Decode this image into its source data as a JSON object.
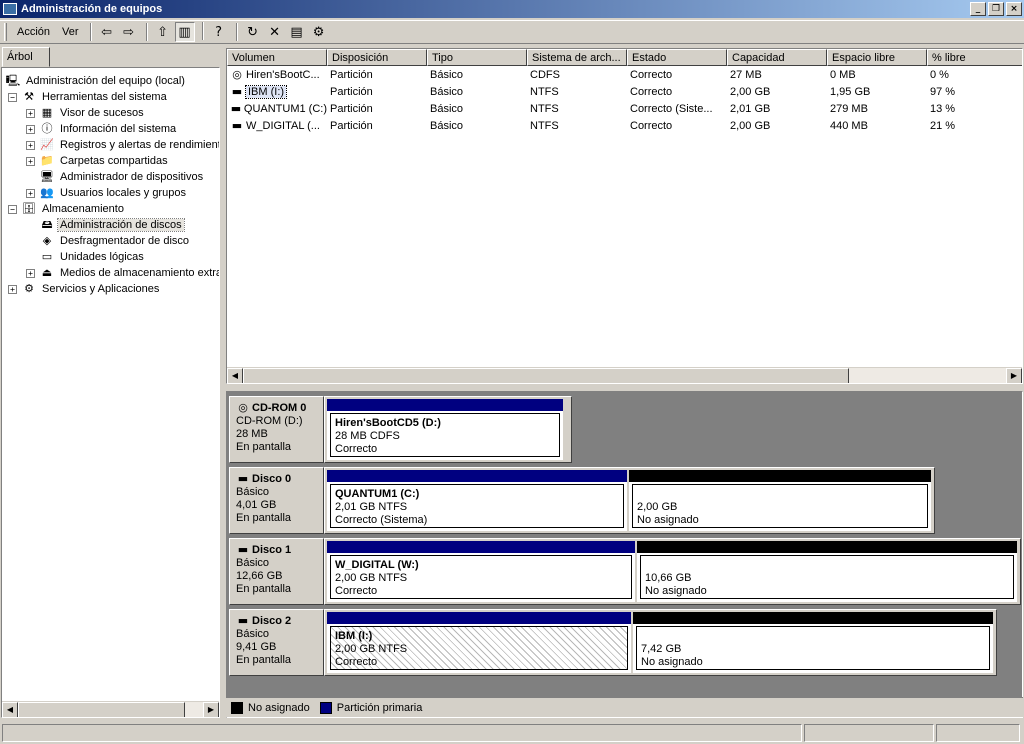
{
  "window": {
    "title": "Administración de equipos",
    "controls": [
      "_",
      "❐",
      "×"
    ]
  },
  "menu": {
    "items": [
      "Acción",
      "Ver"
    ]
  },
  "toolbar": {
    "buttons": [
      {
        "icon": "back-arrow-icon",
        "glyph": "⇦"
      },
      {
        "icon": "forward-arrow-icon",
        "glyph": "⇨"
      },
      {
        "icon": "up-folder-icon",
        "glyph": "⇧"
      },
      {
        "icon": "show-hide-tree-icon",
        "glyph": "▥",
        "pressed": true
      },
      {
        "icon": "help-icon",
        "glyph": "?"
      },
      {
        "icon": "refresh-icon",
        "glyph": "↻"
      },
      {
        "icon": "delete-icon",
        "glyph": "✕"
      },
      {
        "icon": "properties-icon",
        "glyph": "▤"
      },
      {
        "icon": "settings-icon",
        "glyph": "⚙"
      }
    ]
  },
  "tree": {
    "tab_label": "Árbol",
    "items": [
      {
        "label": "Administración del equipo (local)",
        "level": 0,
        "expander": "",
        "icon": "computer-icon",
        "glyph": "🖳"
      },
      {
        "label": "Herramientas del sistema",
        "level": 1,
        "expander": "−",
        "icon": "tools-icon",
        "glyph": "⚒"
      },
      {
        "label": "Visor de sucesos",
        "level": 2,
        "expander": "+",
        "icon": "event-viewer-icon",
        "glyph": "▦"
      },
      {
        "label": "Información del sistema",
        "level": 2,
        "expander": "+",
        "icon": "system-info-icon",
        "glyph": "ⓘ"
      },
      {
        "label": "Registros y alertas de rendimient",
        "level": 2,
        "expander": "+",
        "icon": "performance-icon",
        "glyph": "📈"
      },
      {
        "label": "Carpetas compartidas",
        "level": 2,
        "expander": "+",
        "icon": "shared-folder-icon",
        "glyph": "📁"
      },
      {
        "label": "Administrador de dispositivos",
        "level": 2,
        "expander": "",
        "icon": "device-manager-icon",
        "glyph": "🖥"
      },
      {
        "label": "Usuarios locales y grupos",
        "level": 2,
        "expander": "+",
        "icon": "users-icon",
        "glyph": "👥"
      },
      {
        "label": "Almacenamiento",
        "level": 1,
        "expander": "−",
        "icon": "storage-icon",
        "glyph": "🗄"
      },
      {
        "label": "Administración de discos",
        "level": 2,
        "expander": "",
        "icon": "disk-management-icon",
        "glyph": "🖴",
        "selected": true
      },
      {
        "label": "Desfragmentador de disco",
        "level": 2,
        "expander": "",
        "icon": "defrag-icon",
        "glyph": "◈"
      },
      {
        "label": "Unidades lógicas",
        "level": 2,
        "expander": "",
        "icon": "logical-drive-icon",
        "glyph": "▭"
      },
      {
        "label": "Medios de almacenamiento extraí",
        "level": 2,
        "expander": "+",
        "icon": "removable-storage-icon",
        "glyph": "⏏"
      },
      {
        "label": "Servicios y Aplicaciones",
        "level": 1,
        "expander": "+",
        "icon": "services-icon",
        "glyph": "⚙"
      }
    ]
  },
  "volume_list": {
    "columns": [
      "Volumen",
      "Disposición",
      "Tipo",
      "Sistema de arch...",
      "Estado",
      "Capacidad",
      "Espacio libre",
      "% libre"
    ],
    "rows": [
      {
        "icon": "cdrom-icon",
        "glyph": "◎",
        "cells": [
          "Hiren'sBootC...",
          "Partición",
          "Básico",
          "CDFS",
          "Correcto",
          "27 MB",
          "0 MB",
          "0 %"
        ]
      },
      {
        "icon": "hard-drive-icon",
        "glyph": "▬",
        "cells": [
          "IBM (I:)",
          "Partición",
          "Básico",
          "NTFS",
          "Correcto",
          "2,00 GB",
          "1,95 GB",
          "97 %"
        ],
        "selected": true
      },
      {
        "icon": "hard-drive-icon",
        "glyph": "▬",
        "cells": [
          "QUANTUM1 (C:)",
          "Partición",
          "Básico",
          "NTFS",
          "Correcto (Siste...",
          "2,01 GB",
          "279 MB",
          "13 %"
        ]
      },
      {
        "icon": "hard-drive-icon",
        "glyph": "▬",
        "cells": [
          "W_DIGITAL (...",
          "Partición",
          "Básico",
          "NTFS",
          "Correcto",
          "2,00 GB",
          "440 MB",
          "21 %"
        ]
      }
    ]
  },
  "disks": [
    {
      "name": "CD-ROM 0",
      "icon": "cdrom-icon",
      "type": "CD-ROM (D:)",
      "size": "28 MB",
      "status": "En pantalla",
      "partitions": [
        {
          "kind": "primary",
          "name": "Hiren'sBootCD5  (D:)",
          "detail": "28 MB CDFS",
          "status": "Correcto"
        }
      ]
    },
    {
      "name": "Disco 0",
      "icon": "hard-disk-icon",
      "type": "Básico",
      "size": "4,01 GB",
      "status": "En pantalla",
      "partitions": [
        {
          "kind": "primary",
          "name": "QUANTUM1  (C:)",
          "detail": "2,01 GB NTFS",
          "status": "Correcto (Sistema)"
        },
        {
          "kind": "unallocated",
          "name": "",
          "detail": "2,00 GB",
          "status": "No asignado"
        }
      ]
    },
    {
      "name": "Disco 1",
      "icon": "hard-disk-icon",
      "type": "Básico",
      "size": "12,66 GB",
      "status": "En pantalla",
      "partitions": [
        {
          "kind": "primary",
          "name": "W_DIGITAL  (W:)",
          "detail": "2,00 GB NTFS",
          "status": "Correcto"
        },
        {
          "kind": "unallocated",
          "name": "",
          "detail": "10,66 GB",
          "status": "No asignado"
        }
      ]
    },
    {
      "name": "Disco 2",
      "icon": "hard-disk-icon",
      "type": "Básico",
      "size": "9,41 GB",
      "status": "En pantalla",
      "partitions": [
        {
          "kind": "primary",
          "name": "IBM  (I:)",
          "detail": "2,00 GB NTFS",
          "status": "Correcto",
          "selected": true
        },
        {
          "kind": "unallocated",
          "name": "",
          "detail": "7,42 GB",
          "status": "No asignado"
        }
      ]
    }
  ],
  "legend": [
    {
      "label": "No asignado",
      "color": "#000000"
    },
    {
      "label": "Partición primaria",
      "color": "#000080"
    }
  ],
  "colors": {
    "primary": "#000080",
    "unallocated": "#000000",
    "title_start": "#0a246a",
    "title_end": "#a6caf0"
  }
}
